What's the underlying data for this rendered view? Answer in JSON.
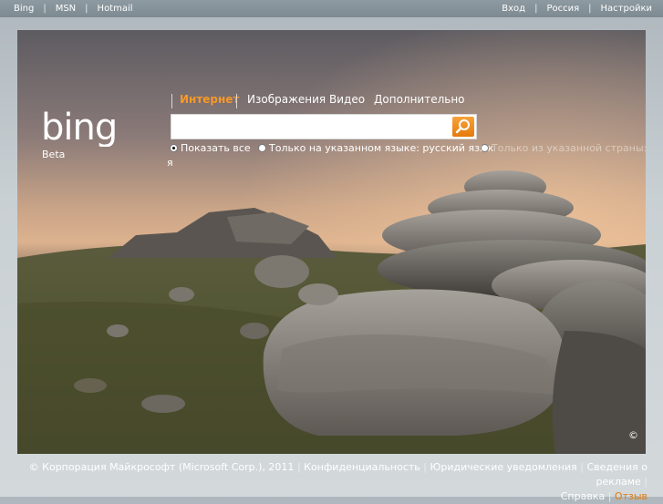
{
  "topbar": {
    "left_links": [
      "Bing",
      "MSN",
      "Hotmail"
    ],
    "right_links": [
      "Вход",
      "Россия",
      "Настройки"
    ],
    "separator": "|"
  },
  "brand": {
    "logo_text": "bing",
    "badge": "Beta"
  },
  "tabs": [
    "Интернет",
    "Изображения",
    "Видео",
    "Дополнительно"
  ],
  "search": {
    "value": "",
    "placeholder": "",
    "button_icon": "search-icon"
  },
  "scope_options": [
    {
      "label": "Показать все",
      "selected": true
    },
    {
      "label": "Только на указанном языке: русский язык",
      "selected": false
    },
    {
      "label": "Только из указанной страны: Россия",
      "selected": false
    }
  ],
  "scope_wrap_fragment": "я",
  "hero": {
    "copyright_mark": "©"
  },
  "footer": {
    "copyright": "© Корпорация Майкрософт (Microsoft Corp.), 2011",
    "links": [
      "Конфиденциальность",
      "Юридические уведомления",
      "Сведения о рекламе",
      "Справка"
    ],
    "feedback": "Отзыв",
    "separator": "|"
  },
  "colors": {
    "accent": "#f89828",
    "feedback": "#e47a0b",
    "search_button": "#f0901f"
  }
}
